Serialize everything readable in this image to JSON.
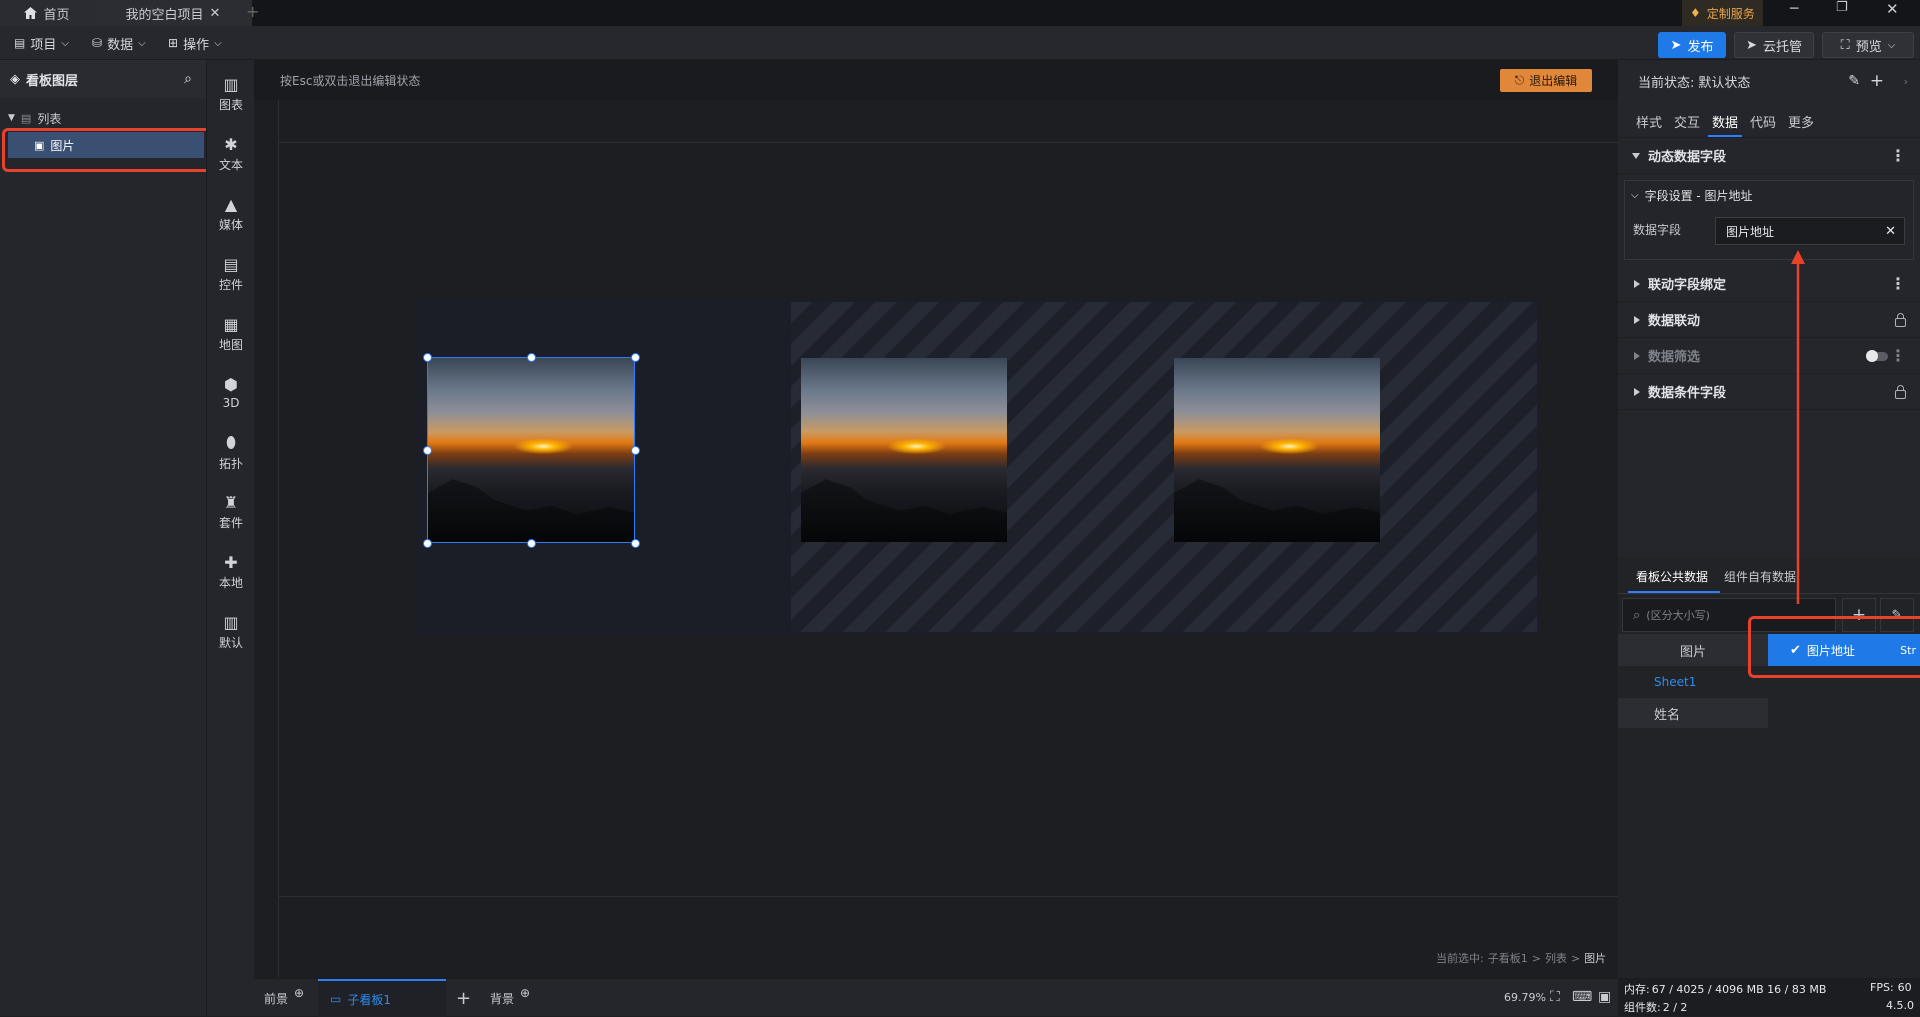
{
  "titlebar": {
    "tab_home": "首页",
    "tab_project": "我的空白项目",
    "custom_service": "定制服务"
  },
  "menubar": {
    "project": "项目",
    "data": "数据",
    "operate": "操作",
    "publish": "发布",
    "cloud": "云托管",
    "preview": "预览"
  },
  "layers": {
    "title": "看板图层",
    "list": "列表",
    "image": "图片"
  },
  "rail": [
    "图表",
    "文本",
    "媒体",
    "控件",
    "地图",
    "3D",
    "拓扑",
    "套件",
    "本地",
    "默认"
  ],
  "workspace": {
    "hint": "按Esc或双击退出编辑状态",
    "exit_edit": "退出编辑",
    "breadcrumb_prefix": "当前选中:",
    "crumb1": "子看板1",
    "crumb2": "列表",
    "crumb3": "图片"
  },
  "right": {
    "state_label": "当前状态:",
    "state_value": "默认状态",
    "tabs": [
      "样式",
      "交互",
      "数据",
      "代码",
      "更多"
    ],
    "dynamic_fields": "动态数据字段",
    "field_setting": "字段设置 - 图片地址",
    "data_field_label": "数据字段",
    "data_field_value": "图片地址",
    "sections": [
      "联动字段绑定",
      "数据联动",
      "数据筛选",
      "数据条件字段"
    ],
    "data_tabs": [
      "看板公共数据",
      "组件自有数据"
    ],
    "search_placeholder": "(区分大小写)",
    "list_head": "图片",
    "sheet": "Sheet1",
    "name_col": "姓名",
    "dropdown_option": "图片地址",
    "dropdown_extra": "Str"
  },
  "bottom": {
    "front": "前景",
    "subboard": "子看板1",
    "back": "背景",
    "zoom": "69.79%"
  },
  "status": {
    "mem_label": "内存:",
    "mem_value": "67 / 4025 / 4096 MB  16 / 83 MB",
    "fps_label": "FPS:",
    "fps_value": "60",
    "count_label": "组件数:",
    "count_value": "2 / 2",
    "version": "4.5.0"
  }
}
